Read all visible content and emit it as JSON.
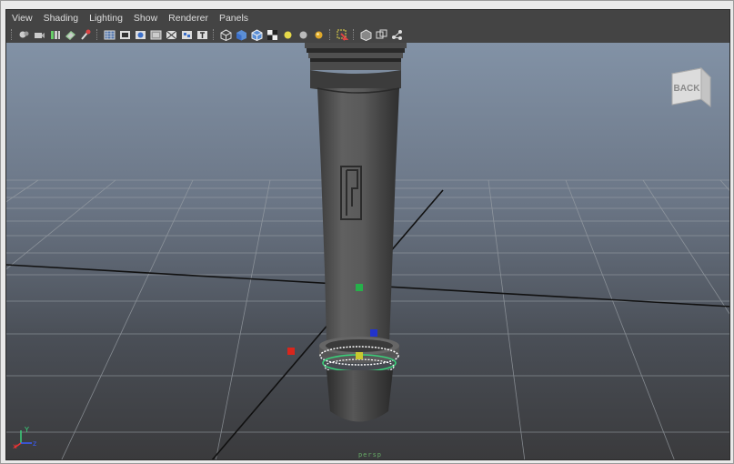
{
  "menubar": {
    "items": [
      "View",
      "Shading",
      "Lighting",
      "Show",
      "Renderer",
      "Panels"
    ]
  },
  "toolbar": {
    "groups": [
      [
        "select-camera-icon",
        "camera-attributes-icon",
        "bookmark-icon",
        "image-plane-icon",
        "camera-tools-icon"
      ],
      [
        "grid-icon",
        "film-gate-icon",
        "resolution-gate-icon",
        "gate-mask-icon",
        "field-chart-icon",
        "safe-action-icon",
        "safe-title-icon"
      ],
      [
        "wireframe-icon",
        "smooth-shade-icon",
        "wireframe-on-shaded-icon",
        "textured-icon",
        "default-light-icon",
        "shadows-icon",
        "high-quality-icon"
      ],
      [
        "isolate-select-icon"
      ],
      [
        "xray-icon",
        "xray-joints-icon",
        "xray-components-icon"
      ]
    ]
  },
  "viewport": {
    "camera_name": "persp",
    "viewcube_face": "BACK",
    "background_top": "#7f8fa3",
    "background_bottom": "#3c3c3c",
    "model_color": "#555555",
    "manipulator_colors": {
      "x": "#d9261c",
      "y": "#26b04a",
      "z": "#2233cc",
      "center": "#c8c830"
    },
    "axis_labels": {
      "x": "x",
      "y": "Y",
      "z": "z"
    }
  }
}
